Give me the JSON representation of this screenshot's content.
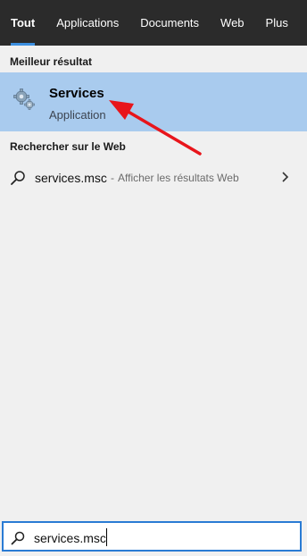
{
  "tabs": [
    {
      "label": "Tout"
    },
    {
      "label": "Applications"
    },
    {
      "label": "Documents"
    },
    {
      "label": "Web"
    },
    {
      "label": "Plus"
    }
  ],
  "best_match": {
    "heading": "Meilleur résultat",
    "title": "Services",
    "subtitle": "Application",
    "icon": "gear-icon"
  },
  "web_search": {
    "heading": "Rechercher sur le Web",
    "query": "services.msc",
    "dash": "-",
    "hint": "Afficher les résultats Web",
    "icon": "search-icon"
  },
  "search_box": {
    "value": "services.msc"
  },
  "colors": {
    "tab_bar": "#2b2b2b",
    "selected_row": "#a9cbee",
    "accent": "#3c8fe0",
    "arrow": "#e8151b"
  }
}
